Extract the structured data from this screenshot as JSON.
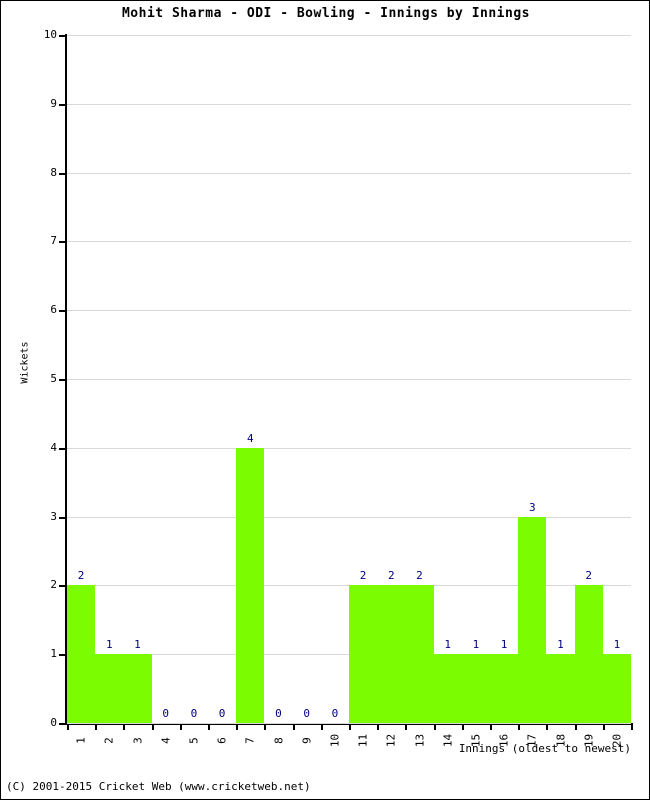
{
  "chart_data": {
    "type": "bar",
    "title": "Mohit Sharma - ODI - Bowling - Innings by Innings",
    "xlabel": "Innings (oldest to newest)",
    "ylabel": "Wickets",
    "categories": [
      "1",
      "2",
      "3",
      "4",
      "5",
      "6",
      "7",
      "8",
      "9",
      "10",
      "11",
      "12",
      "13",
      "14",
      "15",
      "16",
      "17",
      "18",
      "19",
      "20"
    ],
    "values": [
      2,
      1,
      1,
      0,
      0,
      0,
      4,
      0,
      0,
      0,
      2,
      2,
      2,
      1,
      1,
      1,
      3,
      1,
      2,
      1
    ],
    "ylim": [
      0,
      10
    ],
    "yticks": [
      0,
      1,
      2,
      3,
      4,
      5,
      6,
      7,
      8,
      9,
      10
    ],
    "ytick_labels": [
      "0",
      "1",
      "2",
      "3",
      "4",
      "5",
      "6",
      "7",
      "8",
      "9",
      "10"
    ],
    "grid": true,
    "legend": false,
    "bar_color": "#7CFC00",
    "label_color": "#000080",
    "gridline_color": "#d9d9d9",
    "axis_color": "#000000",
    "show_data_labels": true
  },
  "footer": {
    "credit": "(C) 2001-2015 Cricket Web (www.cricketweb.net)"
  }
}
